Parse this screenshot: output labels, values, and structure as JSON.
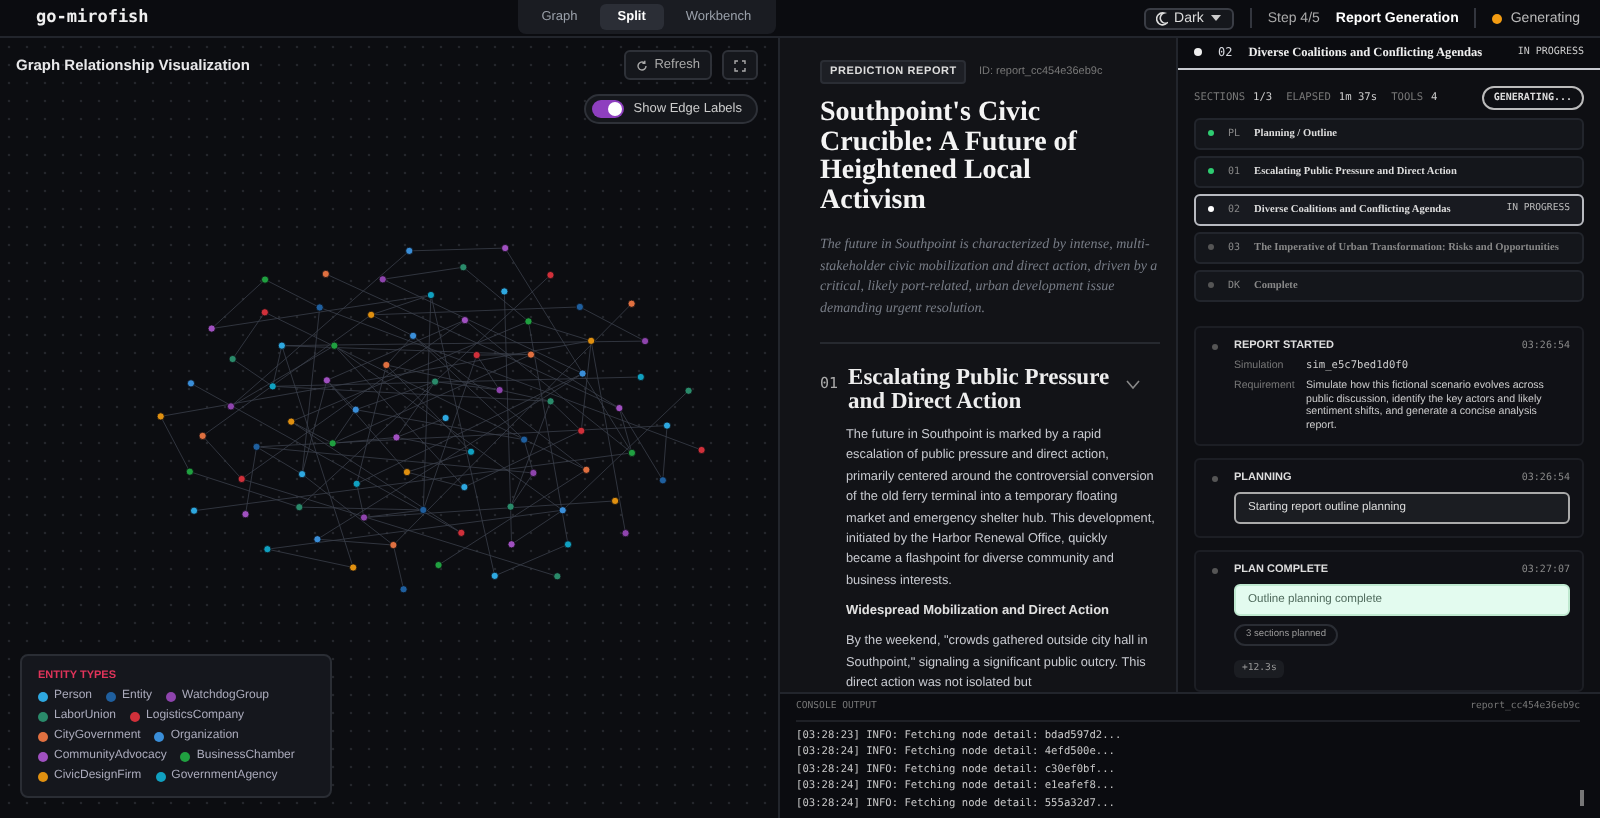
{
  "app": {
    "logo": "go-mirofish"
  },
  "view_tabs": [
    {
      "label": "Graph",
      "selected": false
    },
    {
      "label": "Split",
      "selected": true
    },
    {
      "label": "Workbench",
      "selected": false
    }
  ],
  "theme_select": {
    "value": "Dark"
  },
  "step": {
    "counter": "Step 4/5",
    "name": "Report Generation"
  },
  "run_status": {
    "label": "Generating"
  },
  "graph": {
    "title": "Graph Relationship Visualization",
    "refresh_button": "Refresh",
    "edge_labels_toggle": {
      "label": "Show Edge Labels",
      "on": true
    },
    "legend": {
      "title": "ENTITY TYPES",
      "items": [
        {
          "label": "Person",
          "color": "#2ea8e0"
        },
        {
          "label": "Entity",
          "color": "#1f5f9e"
        },
        {
          "label": "WatchdogGroup",
          "color": "#8e44ad"
        },
        {
          "label": "LaborUnion",
          "color": "#2a8a6a"
        },
        {
          "label": "LogisticsCompany",
          "color": "#d0303a"
        },
        {
          "label": "CityGovernment",
          "color": "#e07040"
        },
        {
          "label": "Organization",
          "color": "#3a8ed8"
        },
        {
          "label": "CommunityAdvocacy",
          "color": "#a050c0"
        },
        {
          "label": "BusinessChamber",
          "color": "#20a040"
        },
        {
          "label": "CivicDesignFirm",
          "color": "#e09010"
        },
        {
          "label": "GovernmentAgency",
          "color": "#10a0c0"
        }
      ]
    }
  },
  "report": {
    "badge": "PREDICTION REPORT",
    "id": "ID: report_cc454e36eb9c",
    "title": "Southpoint's Civic Crucible: A Future of Heightened Local Activism",
    "summary": "The future in Southpoint is characterized by intense, multi-stakeholder civic mobilization and direct action, driven by a critical, likely port-related, urban development issue demanding urgent resolution.",
    "sections": [
      {
        "number": "01",
        "title": "Escalating Public Pressure and Direct Action",
        "expanded": true,
        "blocks": [
          {
            "kind": "paragraph",
            "text": "The future in Southpoint is marked by a rapid escalation of public pressure and direct action, primarily centered around the controversial conversion of the old ferry terminal into a temporary floating market and emergency shelter hub. This development, initiated by the Harbor Renewal Office, quickly became a flashpoint for diverse community and business interests."
          },
          {
            "kind": "subheading",
            "text": "Widespread Mobilization and Direct Action"
          },
          {
            "kind": "paragraph",
            "text": "By the weekend, \"crowds gathered outside city hall in Southpoint,\" signaling a significant public outcry. This direct action was not isolated but"
          }
        ]
      }
    ]
  },
  "progress": {
    "current": {
      "number": "02",
      "title": "Diverse Coalitions and Conflicting Agendas",
      "status": "IN PROGRESS"
    },
    "stats": [
      {
        "label": "SECTIONS",
        "value": "1/3"
      },
      {
        "label": "ELAPSED",
        "value": "1m 37s"
      },
      {
        "label": "TOOLS",
        "value": "4"
      }
    ],
    "generating_button": "GENERATING...",
    "sections": [
      {
        "number": "PL",
        "title": "Planning / Outline",
        "kind": "done",
        "selected": false
      },
      {
        "number": "01",
        "title": "Escalating Public Pressure and Direct Action",
        "kind": "done",
        "selected": false
      },
      {
        "number": "02",
        "title": "Diverse Coalitions and Conflicting Agendas",
        "kind": "active",
        "badge": "IN PROGRESS",
        "selected": true
      },
      {
        "number": "03",
        "title": "The Imperative of Urban Transformation: Risks and Opportunities",
        "kind": "pending",
        "selected": false
      },
      {
        "number": "DK",
        "title": "Complete",
        "kind": "pending",
        "selected": false
      }
    ],
    "events": [
      {
        "kind": "details",
        "title": "REPORT STARTED",
        "time": "03:26:54",
        "fields": [
          {
            "label": "Simulation",
            "value": "sim_e5c7bed1d0f0",
            "kind": "code"
          },
          {
            "label": "Requirement",
            "value": "Simulate how this fictional scenario evolves across public discussion, identify the key actors and likely sentiment shifts, and generate a concise analysis report.",
            "kind": "text"
          }
        ]
      },
      {
        "kind": "message",
        "title": "PLANNING",
        "time": "03:26:54",
        "message": "Starting report outline planning"
      },
      {
        "kind": "success",
        "title": "PLAN COMPLETE",
        "time": "03:27:07",
        "message": "Outline planning complete",
        "pill": "3 sections planned",
        "duration": "+12.3s"
      }
    ]
  },
  "console": {
    "title": "CONSOLE OUTPUT",
    "id": "report_cc454e36eb9c",
    "lines": [
      "[03:28:23] INFO: Fetching node detail: bdad597d2...",
      "[03:28:24] INFO: Fetching node detail: 4efd500e...",
      "[03:28:24] INFO: Fetching node detail: c30ef0bf...",
      "[03:28:24] INFO: Fetching node detail: e1eafef8...",
      "[03:28:24] INFO: Fetching node detail: 555a32d7..."
    ]
  }
}
